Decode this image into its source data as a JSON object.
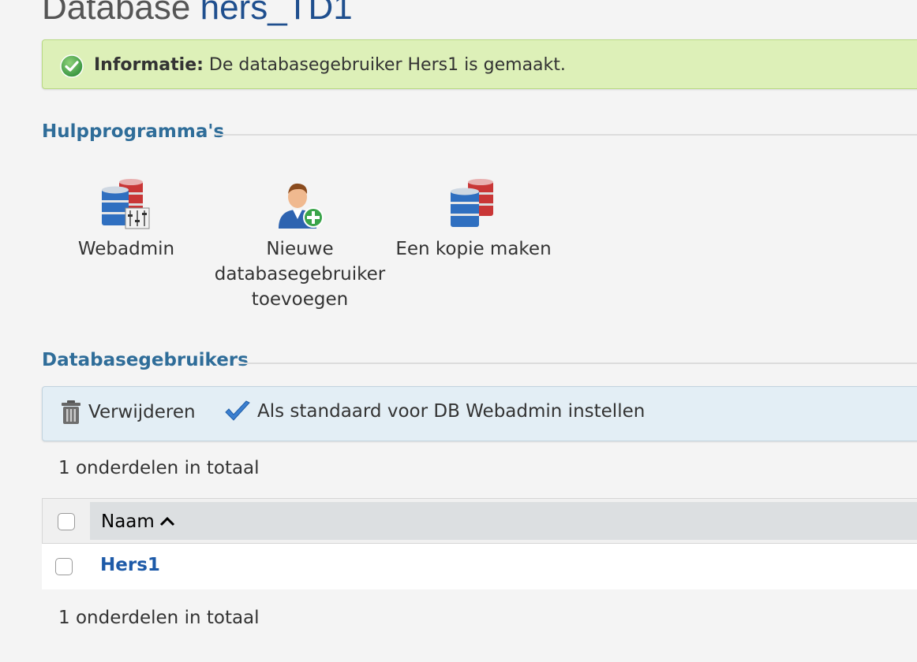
{
  "page": {
    "title_prefix": "Database",
    "title_db": "hers_TD1"
  },
  "message": {
    "label": "Informatie:",
    "text": " De databasegebruiker Hers1 is gemaakt.",
    "status_color": "#ddf0b8"
  },
  "tools_section": {
    "heading": "Hulpprogramma's",
    "items": [
      {
        "label": "Webadmin",
        "icon": "database-settings-icon"
      },
      {
        "label_lines": [
          "Nieuwe",
          "databasegebruiker",
          "toevoegen"
        ],
        "icon": "add-user-icon"
      },
      {
        "label": "Een kopie maken",
        "icon": "database-copy-icon"
      }
    ]
  },
  "users_section": {
    "heading": "Databasegebruikers",
    "toolbar": {
      "delete_label": "Verwijderen",
      "default_label": "Als standaard voor DB Webadmin instellen"
    },
    "count_top": "1 onderdelen in totaal",
    "count_bottom": "1 onderdelen in totaal",
    "table": {
      "columns": [
        "Naam"
      ],
      "sort": "ascending",
      "rows": [
        {
          "name": "Hers1"
        }
      ]
    }
  },
  "colors": {
    "accent": "#2f6d99",
    "link": "#1d5aa8"
  }
}
